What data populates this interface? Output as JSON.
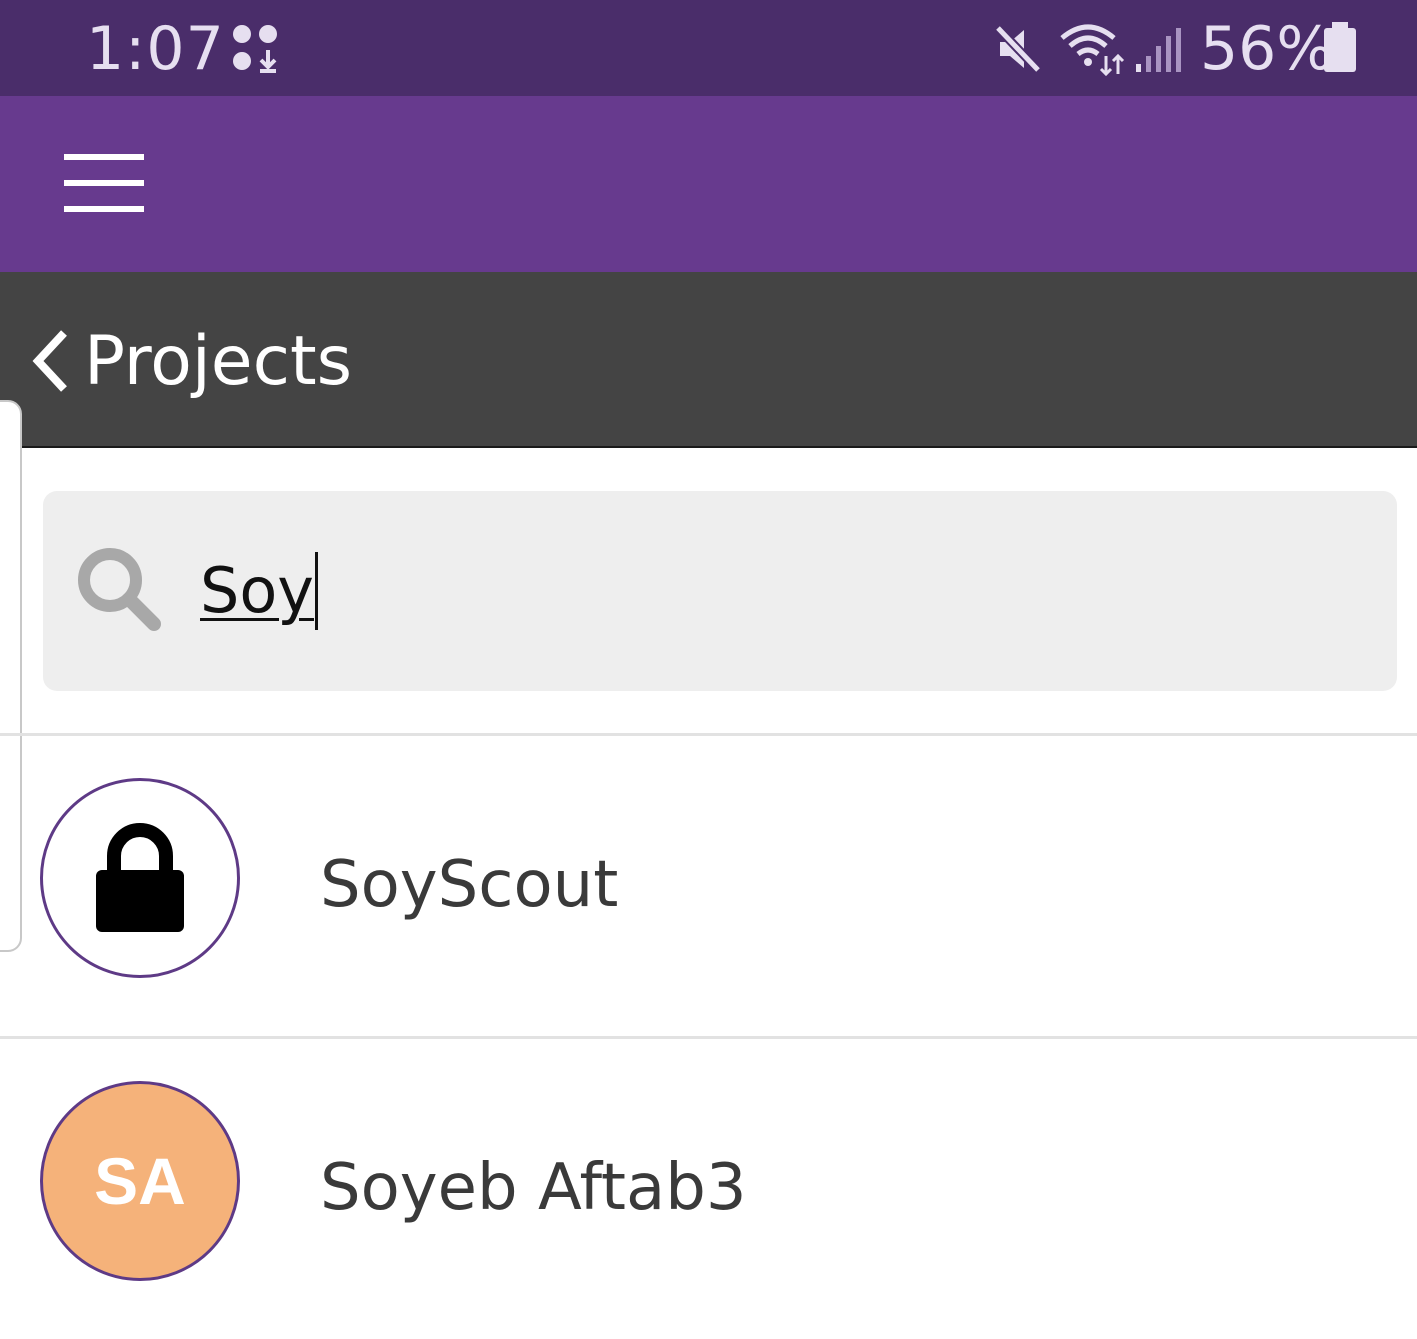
{
  "status_bar": {
    "time": "1:07",
    "battery_percent": "56%",
    "icons": [
      "download-icon",
      "mute-icon",
      "wifi-icon",
      "signal-icon",
      "battery-icon"
    ]
  },
  "app_bar": {
    "menu_icon": "hamburger-menu-icon",
    "background": "#673a8e"
  },
  "section": {
    "back_label": "Projects"
  },
  "search": {
    "value": "Soy",
    "icon": "search-icon"
  },
  "results": [
    {
      "name": "SoyScout",
      "avatar_type": "lock-icon"
    },
    {
      "name": "Soyeb Aftab3",
      "avatar_initials": "SA",
      "avatar_color": "#f5b27a"
    }
  ],
  "colors": {
    "status_bar": "#4a2d6a",
    "accent": "#673a8e",
    "header": "#444444",
    "avatar_border": "#5e3a86"
  }
}
